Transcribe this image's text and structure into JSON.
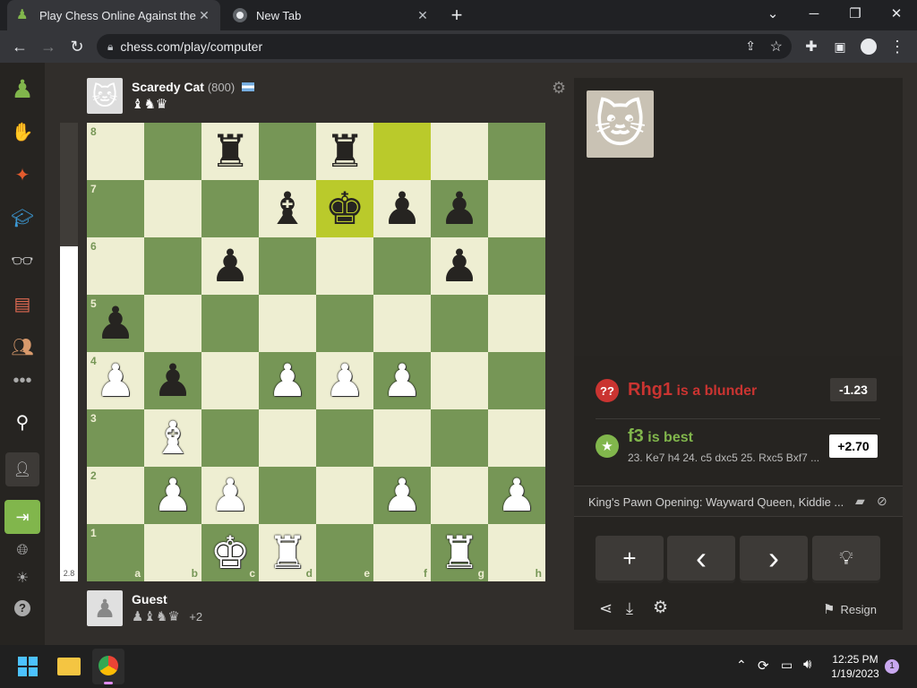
{
  "browser": {
    "tabs": [
      {
        "title": "Play Chess Online Against the Co",
        "active": true,
        "icon": "pawn-favicon"
      },
      {
        "title": "New Tab",
        "active": false,
        "icon": "chrome-favicon"
      }
    ],
    "new_tab_label": "+",
    "url": "chess.com/play/computer",
    "window_controls": [
      "chevron-down-icon",
      "minimize-icon",
      "restore-icon",
      "close-icon"
    ]
  },
  "sidebar": {
    "items": [
      "logo-pawn-icon",
      "play-icon",
      "puzzles-icon",
      "learn-icon",
      "watch-icon",
      "news-icon",
      "social-icon",
      "more-icon",
      "search-icon",
      "add-friend-icon",
      "login-icon",
      "language-icon",
      "theme-icon",
      "help-icon"
    ]
  },
  "opponent": {
    "name": "Scaredy Cat",
    "rating": "(800)",
    "flag": "argentina-flag-icon",
    "captured": "♝♞♛"
  },
  "player": {
    "name": "Guest",
    "captured": "♟♝♞♛",
    "advantage": "+2"
  },
  "eval_bar": {
    "value": "2.8",
    "white_fraction": 0.73
  },
  "board": {
    "ranks": [
      "8",
      "7",
      "6",
      "5",
      "4",
      "3",
      "2",
      "1"
    ],
    "files": [
      "a",
      "b",
      "c",
      "d",
      "e",
      "f",
      "g",
      "h"
    ],
    "highlight_squares": [
      "f8",
      "e7"
    ],
    "pieces": [
      {
        "sq": "c8",
        "p": "♜",
        "c": "b"
      },
      {
        "sq": "e8",
        "p": "♜",
        "c": "b"
      },
      {
        "sq": "d7",
        "p": "♝",
        "c": "b"
      },
      {
        "sq": "e7",
        "p": "♚",
        "c": "b"
      },
      {
        "sq": "f7",
        "p": "♟",
        "c": "b"
      },
      {
        "sq": "g7",
        "p": "♟",
        "c": "b"
      },
      {
        "sq": "c6",
        "p": "♟",
        "c": "b"
      },
      {
        "sq": "g6",
        "p": "♟",
        "c": "b"
      },
      {
        "sq": "a5",
        "p": "♟",
        "c": "b"
      },
      {
        "sq": "a4",
        "p": "♟",
        "c": "w"
      },
      {
        "sq": "b4",
        "p": "♟",
        "c": "b"
      },
      {
        "sq": "d4",
        "p": "♟",
        "c": "w"
      },
      {
        "sq": "e4",
        "p": "♟",
        "c": "w"
      },
      {
        "sq": "f4",
        "p": "♟",
        "c": "w"
      },
      {
        "sq": "b3",
        "p": "♝",
        "c": "w"
      },
      {
        "sq": "b2",
        "p": "♟",
        "c": "w"
      },
      {
        "sq": "c2",
        "p": "♟",
        "c": "w"
      },
      {
        "sq": "f2",
        "p": "♟",
        "c": "w"
      },
      {
        "sq": "h2",
        "p": "♟",
        "c": "w"
      },
      {
        "sq": "c1",
        "p": "♚",
        "c": "w"
      },
      {
        "sq": "d1",
        "p": "♜",
        "c": "w"
      },
      {
        "sq": "g1",
        "p": "♜",
        "c": "w"
      }
    ]
  },
  "analysis": {
    "blunder_move": "Rhg1",
    "blunder_text": "is a blunder",
    "blunder_eval": "-1.23",
    "best_move": "f3",
    "best_text": "is best",
    "best_eval": "+2.70",
    "best_line": "23. Ke7 h4 24. c5 dxc5 25. Rxc5 Bxf7 ...",
    "opening": "King's Pawn Opening: Wayward Queen, Kiddie ..."
  },
  "controls": {
    "new_game": "+",
    "back": "‹",
    "forward": "›",
    "hint": "lightbulb-icon",
    "resign_label": "Resign"
  },
  "taskbar": {
    "time": "12:25 PM",
    "date": "1/19/2023",
    "notification_count": "1"
  },
  "colors": {
    "light_square": "#eeeed2",
    "dark_square": "#769656",
    "blunder": "#ca3431",
    "best": "#81b64c"
  }
}
